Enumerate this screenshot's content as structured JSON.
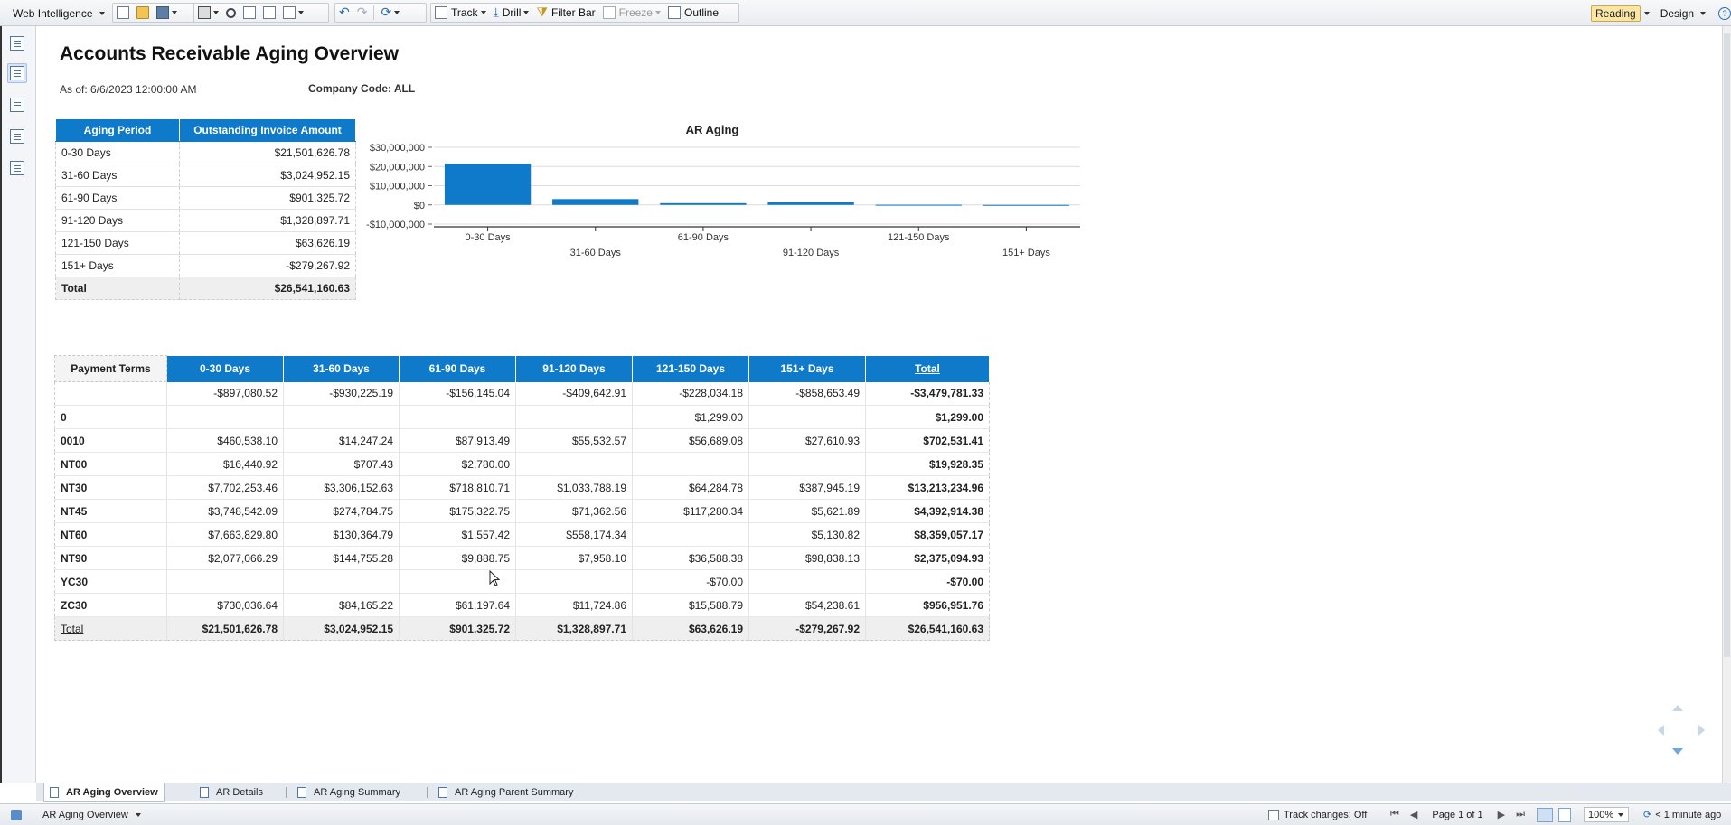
{
  "toolbar": {
    "app_menu": "Web Intelligence",
    "track": "Track",
    "drill": "Drill",
    "filter_bar": "Filter Bar",
    "freeze": "Freeze",
    "outline": "Outline",
    "reading": "Reading",
    "design": "Design",
    "help": "?"
  },
  "report": {
    "title": "Accounts Receivable Aging Overview",
    "as_of": "As of: 6/6/2023 12:00:00 AM",
    "company_code": "Company Code: ALL"
  },
  "summary_table": {
    "headers": [
      "Aging Period",
      "Outstanding Invoice Amount"
    ],
    "rows": [
      [
        "0-30 Days",
        "$21,501,626.78"
      ],
      [
        "31-60 Days",
        "$3,024,952.15"
      ],
      [
        "61-90 Days",
        "$901,325.72"
      ],
      [
        "91-120 Days",
        "$1,328,897.71"
      ],
      [
        "121-150 Days",
        "$63,626.19"
      ],
      [
        "151+ Days",
        "-$279,267.92"
      ]
    ],
    "total": [
      "Total",
      "$26,541,160.63"
    ]
  },
  "chart_data": {
    "type": "bar",
    "title": "AR Aging",
    "categories": [
      "0-30 Days",
      "31-60 Days",
      "61-90 Days",
      "91-120 Days",
      "121-150 Days",
      "151+ Days"
    ],
    "values": [
      21501626.78,
      3024952.15,
      901325.72,
      1328897.71,
      63626.19,
      -279267.92
    ],
    "ylim": [
      -10000000,
      30000000
    ],
    "yticks": [
      30000000,
      20000000,
      10000000,
      0,
      -10000000
    ],
    "ytick_labels": [
      "$30,000,000",
      "$20,000,000",
      "$10,000,000",
      "$0",
      "-$10,000,000"
    ],
    "bar_color": "#0e7ac9",
    "grid": true,
    "xlabel": "",
    "ylabel": ""
  },
  "terms_table": {
    "headers": [
      "Payment Terms",
      "0-30 Days",
      "31-60 Days",
      "61-90 Days",
      "91-120 Days",
      "121-150 Days",
      "151+ Days",
      "Total"
    ],
    "rows": [
      [
        "",
        "-$897,080.52",
        "-$930,225.19",
        "-$156,145.04",
        "-$409,642.91",
        "-$228,034.18",
        "-$858,653.49",
        "-$3,479,781.33"
      ],
      [
        "0",
        "",
        "",
        "",
        "",
        "$1,299.00",
        "",
        "$1,299.00"
      ],
      [
        "0010",
        "$460,538.10",
        "$14,247.24",
        "$87,913.49",
        "$55,532.57",
        "$56,689.08",
        "$27,610.93",
        "$702,531.41"
      ],
      [
        "NT00",
        "$16,440.92",
        "$707.43",
        "$2,780.00",
        "",
        "",
        "",
        "$19,928.35"
      ],
      [
        "NT30",
        "$7,702,253.46",
        "$3,306,152.63",
        "$718,810.71",
        "$1,033,788.19",
        "$64,284.78",
        "$387,945.19",
        "$13,213,234.96"
      ],
      [
        "NT45",
        "$3,748,542.09",
        "$274,784.75",
        "$175,322.75",
        "$71,362.56",
        "$117,280.34",
        "$5,621.89",
        "$4,392,914.38"
      ],
      [
        "NT60",
        "$7,663,829.80",
        "$130,364.79",
        "$1,557.42",
        "$558,174.34",
        "",
        "$5,130.82",
        "$8,359,057.17"
      ],
      [
        "NT90",
        "$2,077,066.29",
        "$144,755.28",
        "$9,888.75",
        "$7,958.10",
        "$36,588.38",
        "$98,838.13",
        "$2,375,094.93"
      ],
      [
        "YC30",
        "",
        "",
        "",
        "",
        "-$70.00",
        "",
        "-$70.00"
      ],
      [
        "ZC30",
        "$730,036.64",
        "$84,165.22",
        "$61,197.64",
        "$11,724.86",
        "$15,588.79",
        "$54,238.61",
        "$956,951.76"
      ]
    ],
    "total": [
      "Total",
      "$21,501,626.78",
      "$3,024,952.15",
      "$901,325.72",
      "$1,328,897.71",
      "$63,626.19",
      "-$279,267.92",
      "$26,541,160.63"
    ]
  },
  "tabs": [
    "AR Aging Overview",
    "AR Details",
    "AR Aging Summary",
    "AR Aging Parent Summary"
  ],
  "status": {
    "report_selector": "AR Aging Overview",
    "track_changes": "Track changes: Off",
    "page": "Page 1 of 1",
    "zoom": "100%",
    "refresh": "< 1 minute ago"
  }
}
